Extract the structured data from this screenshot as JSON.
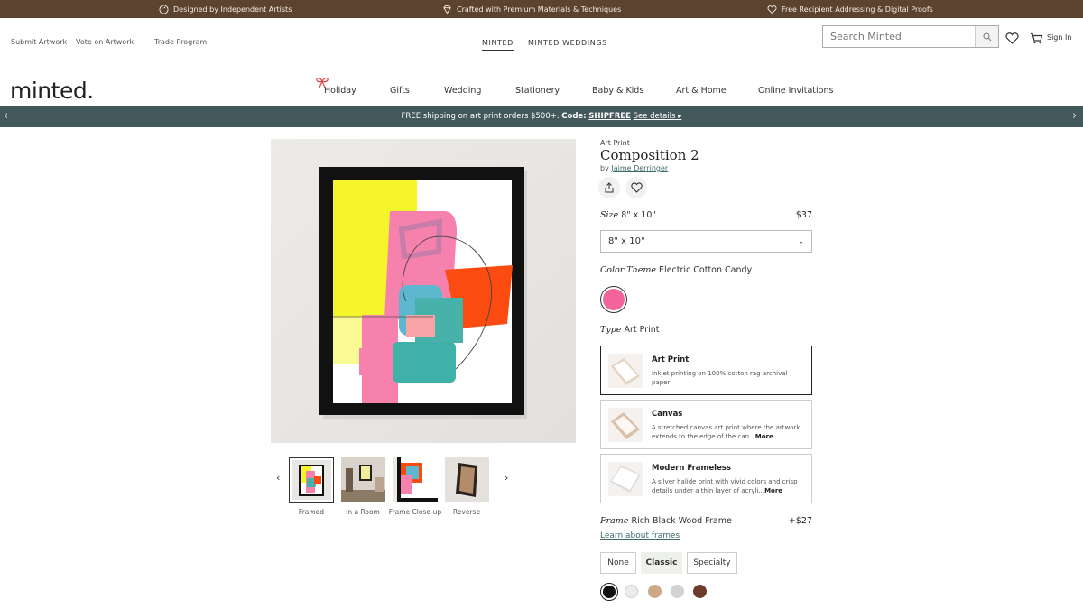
{
  "topbar": {
    "left": "Designed by Independent Artists",
    "center": "Crafted with Premium Materials & Techniques",
    "right": "Free Recipient Addressing & Digital Proofs"
  },
  "header": {
    "util_links": [
      "Submit Artwork",
      "Vote on Artwork",
      "Trade Program"
    ],
    "center_tabs": [
      "MINTED",
      "MINTED WEDDINGS"
    ],
    "search_placeholder": "Search Minted",
    "signin": "Sign In",
    "logo": "minted."
  },
  "nav": [
    "Holiday",
    "Gifts",
    "Wedding",
    "Stationery",
    "Baby & Kids",
    "Art & Home",
    "Online Invitations"
  ],
  "promo": {
    "text": "FREE shipping on art print orders $500+.",
    "code_label": "Code:",
    "code": "SHIPFREE",
    "details": "See details ▸"
  },
  "gallery": {
    "thumbs": [
      "Framed",
      "In a Room",
      "Frame Close-up",
      "Reverse"
    ]
  },
  "product": {
    "eyebrow": "Art Print",
    "title": "Composition 2",
    "by": "by",
    "artist": "Jaime Derringer",
    "size_label": "Size",
    "size_value": "8\" x 10\"",
    "size_price": "$37",
    "size_select": "8\" x 10\"",
    "color_label": "Color Theme",
    "color_value": "Electric Cotton Candy",
    "type_label": "Type",
    "type_value": "Art Print",
    "types": [
      {
        "title": "Art Print",
        "desc": "Inkjet printing on 100% cotton rag archival paper",
        "more": ""
      },
      {
        "title": "Canvas",
        "desc": "A stretched canvas art print where the artwork extends to the edge of the can...",
        "more": "More"
      },
      {
        "title": "Modern Frameless",
        "desc": "A silver halide print with vivid colors and crisp details under a thin layer of acryli...",
        "more": "More"
      }
    ],
    "frame_label": "Frame",
    "frame_value": "Rich Black Wood Frame",
    "frame_price": "+$27",
    "learn_frames": "Learn about frames",
    "frame_styles": [
      "None",
      "Classic",
      "Specialty"
    ]
  },
  "colors": {
    "brown_bar": "#5b432f",
    "promo_bar": "#43585a",
    "swatch_pink": "#f3649b",
    "frame_colors": [
      "#111111",
      "#ececec",
      "#cda98a",
      "#d2d2d2",
      "#6e3b2c"
    ]
  }
}
